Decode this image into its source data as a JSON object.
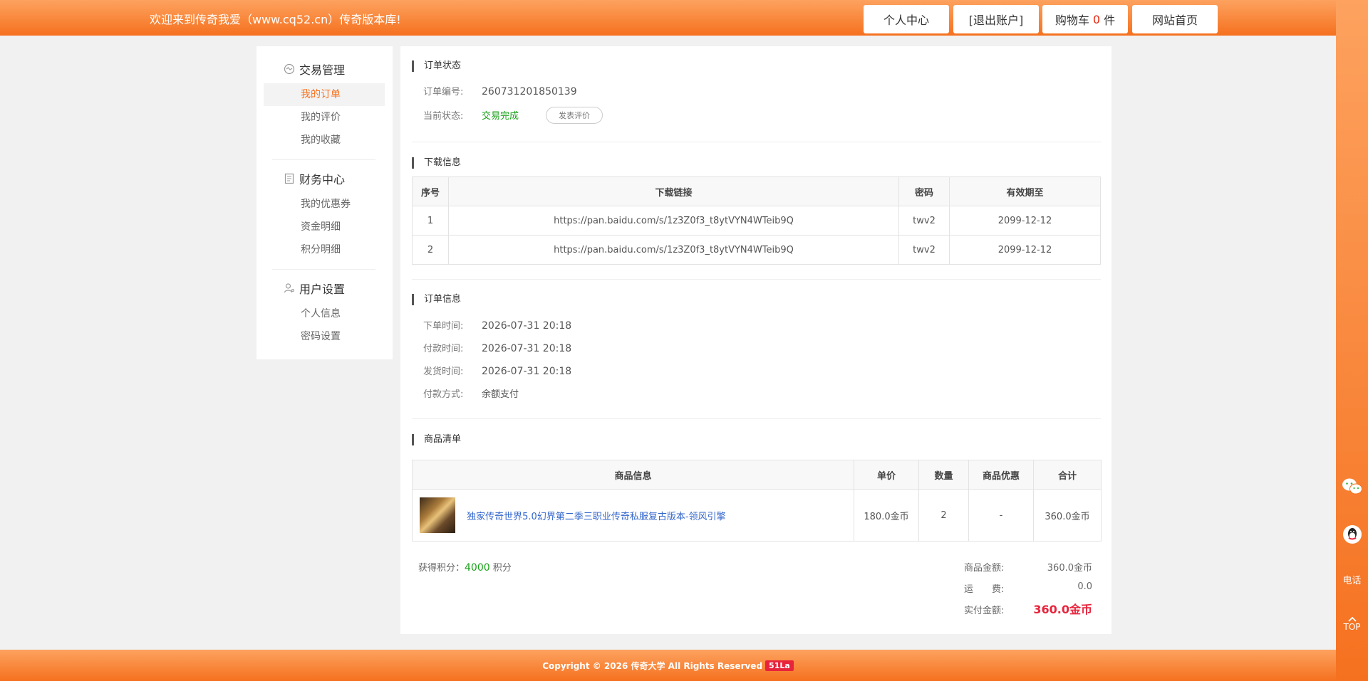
{
  "header": {
    "welcome": "欢迎来到传奇我爱（www.cq52.cn）传奇版本库!",
    "btn_user_center": "个人中心",
    "btn_logout": "[退出账户]",
    "cart_label": "购物车",
    "cart_count": "0",
    "cart_unit": "件",
    "btn_home": "网站首页"
  },
  "leftmenu": {
    "groups": [
      {
        "title": "交易管理",
        "icon": "trade-icon",
        "items": [
          "我的订单",
          "我的评价",
          "我的收藏"
        ]
      },
      {
        "title": "财务中心",
        "icon": "finance-icon",
        "items": [
          "我的优惠券",
          "资金明细",
          "积分明细"
        ]
      },
      {
        "title": "用户设置",
        "icon": "user-settings-icon",
        "items": [
          "个人信息",
          "密码设置"
        ]
      }
    ],
    "active_item": "我的订单"
  },
  "order_status": {
    "title": "订单状态",
    "order_no_label": "订单编号:",
    "order_no": "260731201850139",
    "status_label": "当前状态:",
    "status": "交易完成",
    "review_btn": "发表评价"
  },
  "download": {
    "title": "下载信息",
    "columns": [
      "序号",
      "下载链接",
      "密码",
      "有效期至"
    ],
    "rows": [
      [
        "1",
        "https://pan.baidu.com/s/1z3Z0f3_t8ytVYN4WTeib9Q",
        "twv2",
        "2099-12-12"
      ],
      [
        "2",
        "https://pan.baidu.com/s/1z3Z0f3_t8ytVYN4WTeib9Q",
        "twv2",
        "2099-12-12"
      ]
    ]
  },
  "order_info": {
    "title": "订单信息",
    "order_time_label": "下单时间:",
    "order_time": "2026-07-31 20:18",
    "pay_time_label": "付款时间:",
    "pay_time": "2026-07-31 20:18",
    "ship_time_label": "发货时间:",
    "ship_time": "2026-07-31 20:18",
    "pay_method_label": "付款方式:",
    "pay_method": "余额支付"
  },
  "goods": {
    "title": "商品清单",
    "columns": [
      "商品信息",
      "单价",
      "数量",
      "商品优惠",
      "合计"
    ],
    "item": {
      "name": "独家传奇世界5.0幻界第二季三职业传奇私服复古版本-领风引擎",
      "price": "180.0金币",
      "qty": "2",
      "discount": "-",
      "total": "360.0金币"
    }
  },
  "summary": {
    "points_label": "获得积分：",
    "points": "4000",
    "points_unit": "积分",
    "goods_amount_label": "商品金额:",
    "goods_amount": "360.0金币",
    "freight_label": "运　　费:",
    "freight": "0.0",
    "paid_label": "实付金额:",
    "paid": "360.0金币"
  },
  "float": {
    "phone": "电话",
    "top": "TOP"
  },
  "footer": {
    "copyright": "Copyright © 2026 传奇大学 All Rights Reserved",
    "badge": "51La"
  },
  "colors": {
    "accent": "#f5711f",
    "success": "#1aa11a",
    "price": "#e8243c",
    "link": "#3366cc"
  }
}
